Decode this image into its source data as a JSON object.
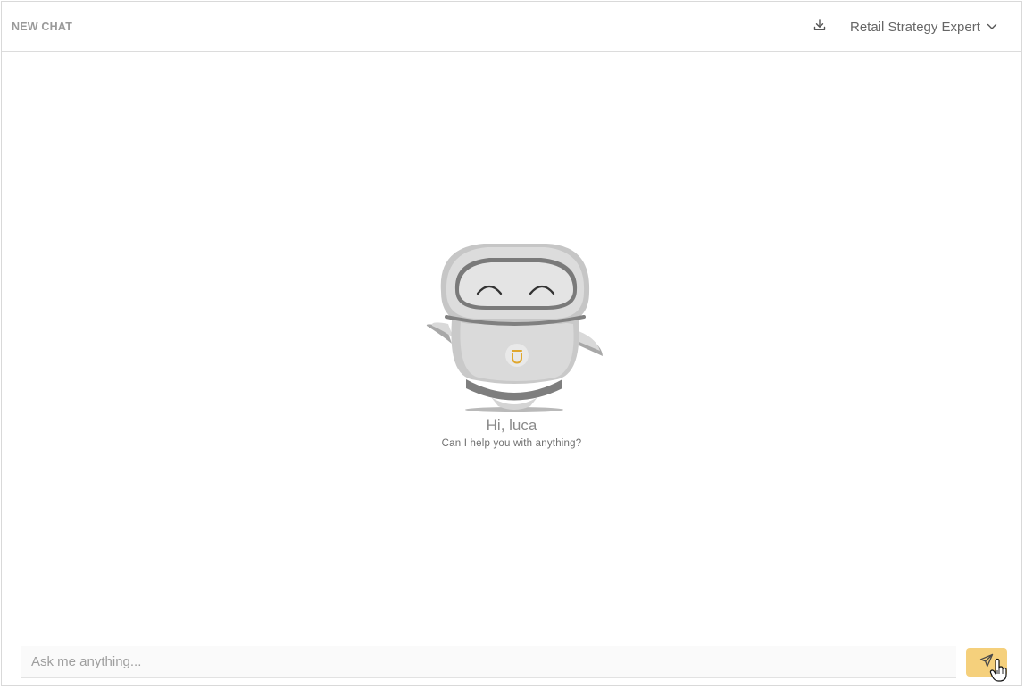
{
  "header": {
    "title": "NEW CHAT",
    "download_icon": "download-icon",
    "agent_selected": "Retail Strategy Expert",
    "dropdown_icon": "chevron-down-icon"
  },
  "main": {
    "illustration": "robot-mascot",
    "greeting": "Hi, luca",
    "subgreeting": "Can I help you with anything?"
  },
  "composer": {
    "placeholder": "Ask me anything...",
    "value": "",
    "send_icon": "send-icon"
  },
  "colors": {
    "accent": "#f5d07c",
    "logo_accent": "#e0a72e"
  }
}
